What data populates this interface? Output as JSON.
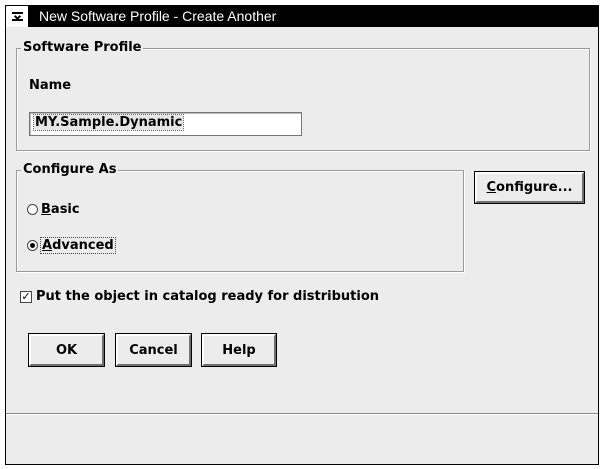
{
  "window": {
    "title": "New Software Profile - Create Another"
  },
  "software_profile": {
    "legend": "Software Profile",
    "name_label": "Name",
    "name_value": "MY.Sample.Dynamic"
  },
  "configure_as": {
    "legend": "Configure As",
    "options": [
      {
        "mnemonic": "B",
        "rest": "asic",
        "selected": false
      },
      {
        "mnemonic": "A",
        "rest": "dvanced",
        "selected": true
      }
    ],
    "configure_button": {
      "mnemonic": "C",
      "rest": "onfigure..."
    }
  },
  "catalog_checkbox": {
    "checked": true,
    "label": "Put the object in catalog ready for distribution"
  },
  "buttons": {
    "ok": "OK",
    "cancel": "Cancel",
    "help": "Help"
  },
  "icons": {
    "system_menu": "system-menu-icon",
    "check": "checkmark-icon"
  }
}
